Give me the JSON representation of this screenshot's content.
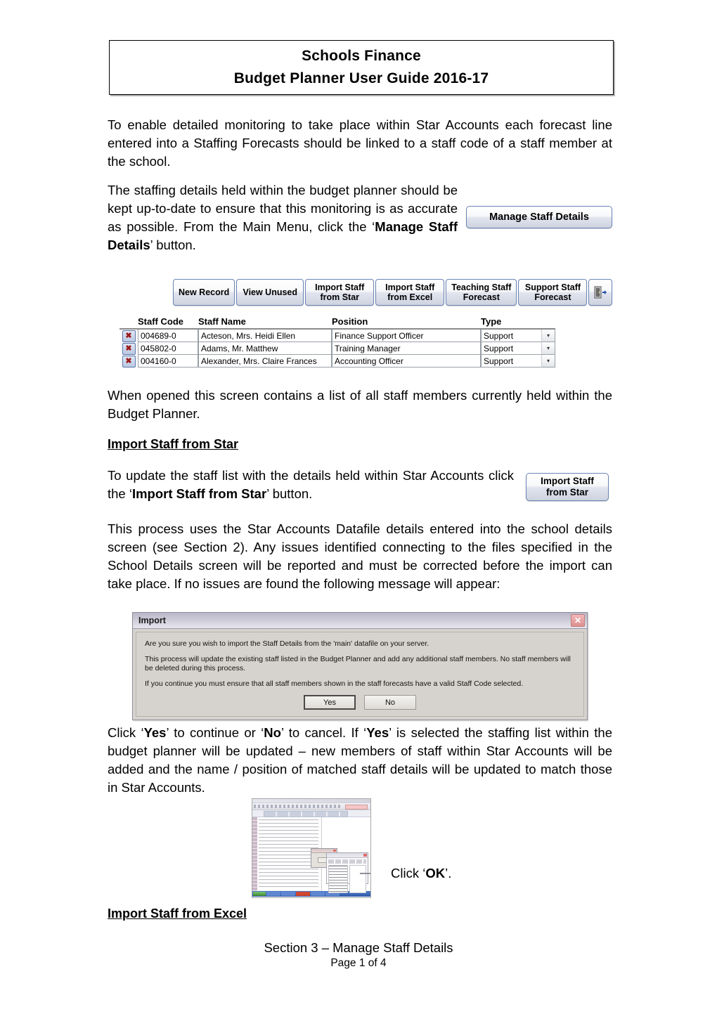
{
  "header": {
    "line1": "Schools Finance",
    "line2": "Budget Planner User Guide 2016-17"
  },
  "paragraphs": {
    "p1": "To enable detailed monitoring to take place within Star Accounts each forecast line entered into a Staffing Forecasts should be linked to a staff code of a staff member at the school.",
    "p2_a": "The staffing details held within the budget planner should be kept up-to-date to ensure that this monitoring is as accurate as possible.  From the Main Menu, click the ‘",
    "p2_b": "Manage Staff Details",
    "p2_c": "’ button.",
    "p3": "When opened this screen contains a list of all staff members currently held within the Budget Planner.",
    "p4_a": "To update the staff list with the details held within Star Accounts click the ‘",
    "p4_b": "Import Staff from Star",
    "p4_c": "’ button.",
    "p5": "This process uses the Star Accounts Datafile details entered into the school details screen (see Section 2).  Any issues identified connecting to the files specified in the School Details screen will be reported and must be corrected before the import can take place.  If no issues are found the following message will appear:",
    "p6_a": "Click ‘",
    "p6_yes1": "Yes",
    "p6_b": "’ to continue or ‘",
    "p6_no": "No",
    "p6_c": "’ to cancel.   If ‘",
    "p6_yes2": "Yes",
    "p6_d": "’ is selected the staffing list within the budget planner will be updated – new members of staff within Star Accounts will be added and the name / position of matched staff details will be updated to match those in Star Accounts.",
    "click_ok_a": "Click ‘",
    "click_ok_b": "OK",
    "click_ok_c": "’."
  },
  "headings": {
    "import_star": "Import Staff from Star",
    "import_excel": "Import Staff from Excel"
  },
  "buttons": {
    "manage_staff_details": "Manage Staff Details",
    "import_staff_from_star_line1": "Import Staff",
    "import_staff_from_star_line2": "from Star"
  },
  "toolbar": {
    "items": [
      {
        "line1": "New Record",
        "line2": ""
      },
      {
        "line1": "View Unused",
        "line2": ""
      },
      {
        "line1": "Import Staff",
        "line2": "from Star"
      },
      {
        "line1": "Import Staff",
        "line2": "from Excel"
      },
      {
        "line1": "Teaching Staff",
        "line2": "Forecast"
      },
      {
        "line1": "Support Staff",
        "line2": "Forecast"
      }
    ],
    "exit_icon": "exit-door-icon"
  },
  "staff_table": {
    "columns": [
      "Staff Code",
      "Staff Name",
      "Position",
      "Type"
    ],
    "rows": [
      {
        "delete": "✖",
        "code": "004689-0",
        "name": "Acteson, Mrs. Heidi Ellen",
        "position": "Finance Support Officer",
        "type": "Support"
      },
      {
        "delete": "✖",
        "code": "045802-0",
        "name": "Adams, Mr. Matthew",
        "position": "Training Manager",
        "type": "Support"
      },
      {
        "delete": "✖",
        "code": "004160-0",
        "name": "Alexander, Mrs. Claire Frances",
        "position": "Accounting Officer",
        "type": "Support"
      }
    ],
    "dropdown_caret": "▾"
  },
  "import_dialog": {
    "title": "Import",
    "close_label": "✕",
    "text1": "Are you sure you wish to import the Staff Details from the 'main' datafile on your server.",
    "text2": "This process will update the existing staff listed in the Budget Planner and add any additional staff members.  No staff members will be deleted during this process.",
    "text3": "If you continue you must ensure that all staff members shown in the staff forecasts have a valid Staff Code selected.",
    "yes_label": "Yes",
    "no_label": "No"
  },
  "footer": {
    "section": "Section 3 – Manage Staff Details",
    "page": "Page 1 of 4"
  },
  "colors": {
    "button_border": "#6b84b5",
    "dialog_face": "#d6d3ce",
    "dialog_close": "#dd8f8f",
    "delete_icon": "#9c1a1a"
  }
}
